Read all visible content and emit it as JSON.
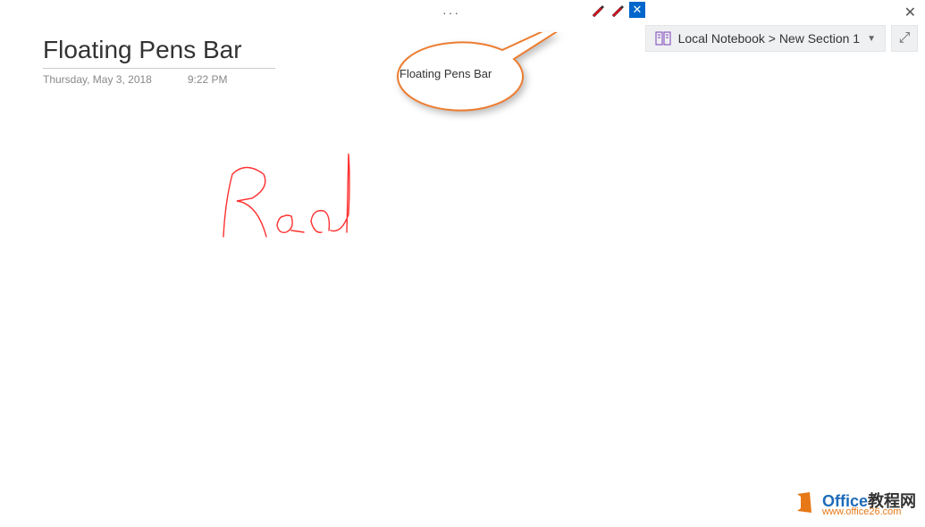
{
  "topbar": {
    "ellipsis": "···"
  },
  "pens": {
    "close_label": "✕"
  },
  "window": {
    "close_label": "✕"
  },
  "breadcrumb": {
    "text": "Local Notebook > New Section 1",
    "caret": "▼"
  },
  "expand": {
    "glyph": "⤢"
  },
  "page": {
    "title": "Floating Pens Bar",
    "date": "Thursday, May 3, 2018",
    "time": "9:22 PM"
  },
  "callout": {
    "label": "Floating Pens Bar"
  },
  "ink": {
    "text": "Red"
  },
  "watermark": {
    "brand_a": "Office",
    "brand_b": "教程网",
    "url": "www.office26.com"
  }
}
